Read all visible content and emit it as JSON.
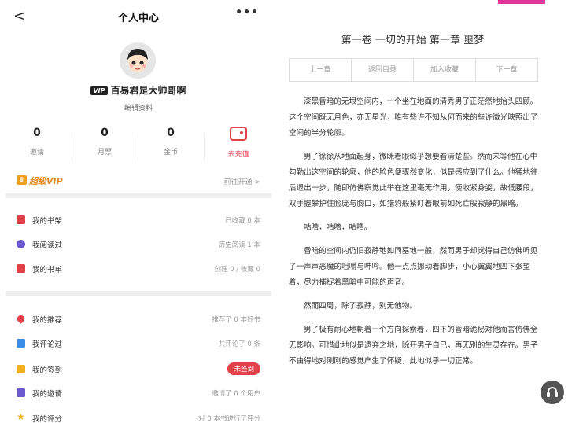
{
  "header": {
    "title": "个人中心",
    "back": "<",
    "more": "•••"
  },
  "profile": {
    "vip_tag": "VIP",
    "username": "百易君是大帅哥啊",
    "edit": "编辑资料"
  },
  "stats": [
    {
      "num": "0",
      "label": "邀请"
    },
    {
      "num": "0",
      "label": "月票"
    },
    {
      "num": "0",
      "label": "金币"
    }
  ],
  "recharge": {
    "label": "去充值"
  },
  "vip": {
    "label": "超级VIP",
    "link": "前往开通 >"
  },
  "list1": [
    {
      "name": "我的书架",
      "value": "已收藏 0 本",
      "color": "#e2414a"
    },
    {
      "name": "我阅读过",
      "value": "历史阅读 1 本",
      "color": "#6a5acd"
    },
    {
      "name": "我的书单",
      "value": "创建 0 / 收藏 0",
      "color": "#e2414a"
    }
  ],
  "list2": [
    {
      "name": "我的推荐",
      "value": "推荐了 0 本好书",
      "color": "#e2414a"
    },
    {
      "name": "我评论过",
      "value": "共评论了 0 条",
      "color": "#3a8ee6"
    },
    {
      "name": "我的签到",
      "value": "未签到",
      "color": "#f0b020"
    },
    {
      "name": "我的邀请",
      "value": "邀请了 0 个用户",
      "color": "#6a5acd"
    },
    {
      "name": "我的评分",
      "value": "对 0 本书进行了评分",
      "color": "#f0b020"
    }
  ],
  "reader": {
    "chapter_title": "第一卷 一切的开始 第一章 噩梦",
    "nav": [
      "上一章",
      "返回目录",
      "加入收藏",
      "下一章"
    ],
    "paragraphs": [
      "漆黑昏暗的无垠空间内，一个坐在地面的清秀男子正茫然地抬头四顾。这个空间既无月色，亦无星光，唯有些许不知从何而来的些许微光映照出了空间的半分轮廓。",
      "男子徐徐从地面起身，微眯着眼似乎想要看清楚些。然而未等他在心中勾勒出这空间的轮廓，他的脸色便骤然变化，似是感应到了什么。他猛地往后退出一步，随即仿佛察觉此举在这里毫无作用，便收紧身姿，故低腰段，双手握攀护住脸庞与胸口，如猎豹般紧盯着眼前如死亡般寂静的黑暗。",
      "咕噜，咕噜，咕噜。",
      "昏暗的空间内仍旧寂静地如同墓地一般，然而男子却觉得自己仿佛听见了一声声恶魔的咀嚼与呻吟。他一点点挪动着脚步，小心翼翼地四下张望着，尽力捕捉着黑暗中可能的声音。",
      "然而四周，除了寂静，别无他物。",
      "男子极有耐心地朝着一个方向探索着，四下的昏暗诡秘对他而言仿佛全无影响。可惜此地似是遗弃之地，除开男子自己，再无别的生灵存在。男子不由得地对刚刚的感觉产生了怀疑，此地似乎一切正常。"
    ]
  }
}
